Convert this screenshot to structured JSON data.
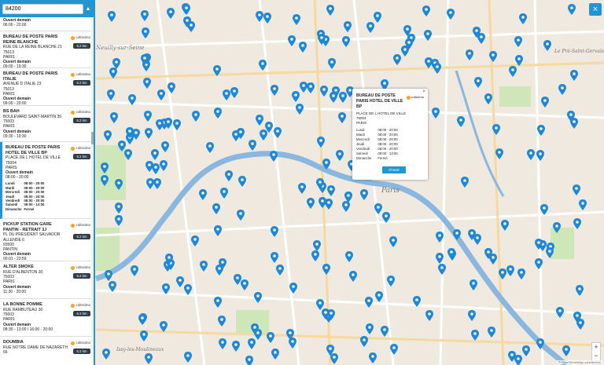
{
  "search": {
    "value": "84200"
  },
  "map": {
    "labels": {
      "neuilly": "Neuilly-sur-Seine",
      "pre_st_gervais": "Le Pré-Saint-Gervais",
      "issy": "Issy-les-Moulineaux",
      "paris": "Paris"
    },
    "close_label": "×",
    "zoom_in": "+",
    "zoom_out": "−",
    "attribution": "© OpenStreetMap contributors"
  },
  "brand_label": "colissimo",
  "items": [
    {
      "name": "",
      "addr1": "",
      "addr2": "",
      "city": "",
      "open": "Ouvert demain",
      "hours_line": "06:00 - 22:00",
      "dist": ""
    },
    {
      "name": "BUREAU DE POSTE PARIS REINE BLANCHE",
      "addr1": "RUE DE LA REINE BLANCHE 21",
      "addr2": "75013",
      "city": "PARIS",
      "open": "Ouvert demain",
      "hours_line": "09:00 - 19:30",
      "dist": "6.2 km"
    },
    {
      "name": "BUREAU DE POSTE PARIS ITALIE",
      "addr1": "AVENUE D ITALIE 23",
      "addr2": "75013",
      "city": "PARIS",
      "open": "Ouvert demain",
      "hours_line": "09:00 - 20:00",
      "dist": "6.2 km"
    },
    {
      "name": "BS BAH",
      "addr1": "BOULEVARD SAINT-MARTIN 35",
      "addr2": "75003",
      "city": "PARIS",
      "open": "Ouvert demain",
      "hours_line": "09:30 - 19:30",
      "dist": "6.2 km"
    },
    {
      "name": "BUREAU DE POSTE PARIS HOTEL DE VILLE BP",
      "addr1": "PLACE DE L HOTEL DE VILLE",
      "addr2": "75004",
      "city": "PARIS",
      "open": "Ouvert demain",
      "hours_line": "08:00 - 20:00",
      "dist": "6.2 km",
      "hours": [
        {
          "day": "Lundi",
          "time": "08:00 - 20:00"
        },
        {
          "day": "Mardi",
          "time": "08:00 - 20:00"
        },
        {
          "day": "Mercredi",
          "time": "08:00 - 20:00"
        },
        {
          "day": "Jeudi",
          "time": "08:00 - 20:00"
        },
        {
          "day": "Vendredi",
          "time": "08:00 - 20:00"
        },
        {
          "day": "Samedi",
          "time": "09:00 - 13:00"
        },
        {
          "day": "Dimanche",
          "time": "Fermé"
        }
      ]
    },
    {
      "name": "PICKUP STATION GARE PANTIN - RETRAIT 3J",
      "addr1": "PL DU PRESIDENT SALVADOR ALLENDE 6",
      "addr2": "93500",
      "city": "PANTIN",
      "open": "Ouvert demain",
      "hours_line": "00:01 - 23:59",
      "dist": "6.2 km"
    },
    {
      "name": "ALTER SMOKE",
      "addr1": "RUE D'ALBENTON 30",
      "addr2": "75003",
      "city": "PARIS",
      "open": "Ouvert demain",
      "hours_line": "11:30 - 20:00",
      "dist": "6.2 km"
    },
    {
      "name": "LA BONNE POMME",
      "addr1": "RUE RAMBUTEAU 30",
      "addr2": "75003",
      "city": "PARIS",
      "open": "Ouvert demain",
      "hours_line": "08:30 - 13:00 / 16:00 - 20:00",
      "dist": "6.2 km"
    },
    {
      "name": "DOUMBIA",
      "addr1": "RUE NOTRE DAME DE NAZARETH 66",
      "addr2": "",
      "city": "",
      "open": "",
      "hours_line": "",
      "dist": "6.2 km"
    }
  ],
  "popup": {
    "close": "×",
    "title": "BUREAU DE POSTE PARIS HOTEL DE VILLE BP",
    "addr1": "PLACE DE L HOTEL DE VILLE",
    "addr2": "75004",
    "city": "PARIS",
    "hours": [
      {
        "day": "Lundi",
        "time": "08:00 - 20:00"
      },
      {
        "day": "Mardi",
        "time": "08:00 - 20:00"
      },
      {
        "day": "Mercredi",
        "time": "08:00 - 20:00"
      },
      {
        "day": "Jeudi",
        "time": "08:00 - 20:00"
      },
      {
        "day": "Vendredi",
        "time": "08:00 - 20:00"
      },
      {
        "day": "Samedi",
        "time": "09:00 - 13:00"
      },
      {
        "day": "Dimanche",
        "time": "Fermé"
      }
    ],
    "choose_label": "Choisir"
  },
  "colors": {
    "accent": "#2196d3",
    "pin": "#1e88d6",
    "distance_badge": "#2f3e4a",
    "brand": "#f5a623"
  }
}
